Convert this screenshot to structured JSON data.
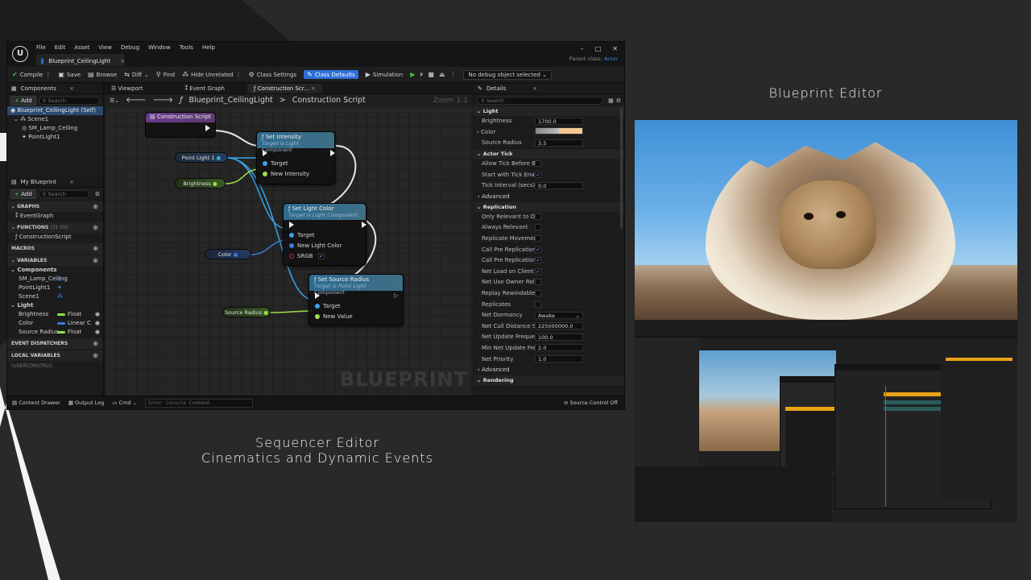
{
  "slide": {
    "caption_left_line1": "Sequencer Editor",
    "caption_left_line2": "Cinematics and Dynamic Events",
    "caption_right": "Blueprint Editor"
  },
  "editor": {
    "menu": [
      "File",
      "Edit",
      "Asset",
      "View",
      "Debug",
      "Window",
      "Tools",
      "Help"
    ],
    "tab": "Blueprint_CeilingLight",
    "parent_class_label": "Parent class:",
    "parent_class_value": "Actor",
    "toolbar": {
      "compile": "Compile",
      "save": "Save",
      "browse": "Browse",
      "diff": "Diff",
      "find": "Find",
      "hide_unrelated": "Hide Unrelated",
      "class_settings": "Class Settings",
      "class_defaults": "Class Defaults",
      "simulation": "Simulation",
      "debug_object": "No debug object selected"
    },
    "components": {
      "tab": "Components",
      "add": "Add",
      "search_placeholder": "Search",
      "items": [
        "Blueprint_CeilingLight (Self)",
        "Scene1",
        "SM_Lamp_Ceiling",
        "PointLight1"
      ]
    },
    "my_blueprint": {
      "tab": "My Blueprint",
      "add": "Add",
      "search_placeholder": "Search",
      "graphs": "GRAPHS",
      "event_graph": "EventGraph",
      "functions": "FUNCTIONS",
      "functions_count": "(31 OVI",
      "construction_script": "ConstructionScript",
      "macros": "MACROS",
      "variables": "VARIABLES",
      "components_group": "Components",
      "component_vars": [
        "SM_Lamp_Ceiling",
        "PointLight1",
        "Scene1"
      ],
      "light_group": "Light",
      "light_vars": [
        {
          "name": "Brightness",
          "type": "Float"
        },
        {
          "name": "Color",
          "type": "Linear C"
        },
        {
          "name": "Source Radius",
          "type": "Float"
        }
      ],
      "event_dispatchers": "EVENT DISPATCHERS",
      "local_variables": "LOCAL VARIABLES",
      "local_variables_scope": "(USERCONSTRUC"
    },
    "graph_tabs": [
      "Viewport",
      "Event Graph",
      "Construction Scr..."
    ],
    "breadcrumb": {
      "class": "Blueprint_CeilingLight",
      "separator": ">",
      "graph": "Construction Script",
      "zoom": "Zoom 1:1"
    },
    "graph": {
      "watermark": "BLUEPRINT",
      "construction_script": "Construction Script",
      "vars": [
        "Point Light 1",
        "Brightness",
        "Color",
        "Source Radius"
      ],
      "set_intensity": {
        "title": "Set Intensity",
        "sub": "Target is Light Component",
        "pins": [
          "Target",
          "New Intensity"
        ]
      },
      "set_light_color": {
        "title": "Set Light Color",
        "sub": "Target is Light Component",
        "pins": [
          "Target",
          "New Light Color",
          "SRGB"
        ]
      },
      "set_source_radius": {
        "title": "Set Source Radius",
        "sub": "Target is Point Light Component",
        "pins": [
          "Target",
          "New Value"
        ]
      }
    },
    "details": {
      "tab": "Details",
      "search_placeholder": "Search",
      "light_header": "Light",
      "light_rows": [
        {
          "label": "Brightness",
          "value": "1700.0"
        },
        {
          "label": "Color",
          "value": ""
        },
        {
          "label": "Source Radius",
          "value": "3.5"
        }
      ],
      "actor_tick_header": "Actor Tick",
      "tick_rows": [
        {
          "label": "Allow Tick Before Begi...",
          "checked": false
        },
        {
          "label": "Start with Tick Enabled",
          "checked": true
        }
      ],
      "tick_interval_label": "Tick Interval (secs)",
      "tick_interval_value": "0.0",
      "advanced": "Advanced",
      "replication_header": "Replication",
      "replication_rows": [
        {
          "label": "Only Relevant to Owner",
          "checked": false
        },
        {
          "label": "Always Relevant",
          "checked": false
        },
        {
          "label": "Replicate Movement",
          "checked": false
        },
        {
          "label": "Call Pre Replication",
          "checked": true
        },
        {
          "label": "Call Pre Replication fo...",
          "checked": true
        },
        {
          "label": "Net Load on Client",
          "checked": true
        },
        {
          "label": "Net Use Owner Releva...",
          "checked": false
        },
        {
          "label": "Replay Rewindable",
          "checked": false
        },
        {
          "label": "Replicates",
          "checked": false
        }
      ],
      "value_rows": [
        {
          "label": "Net Dormancy",
          "value": "Awake"
        },
        {
          "label": "Net Cull Distance Squ...",
          "value": "225000000.0"
        },
        {
          "label": "Net Update Frequency",
          "value": "100.0"
        },
        {
          "label": "Min Net Update Frequ...",
          "value": "2.0"
        },
        {
          "label": "Net Priority",
          "value": "1.0"
        }
      ],
      "advanced2": "Advanced",
      "rendering_header": "Rendering"
    },
    "status": {
      "content_drawer": "Content Drawer",
      "output_log": "Output Log",
      "cmd": "Cmd",
      "console_placeholder": "Enter Console Command",
      "source_control": "Source Control Off"
    }
  }
}
